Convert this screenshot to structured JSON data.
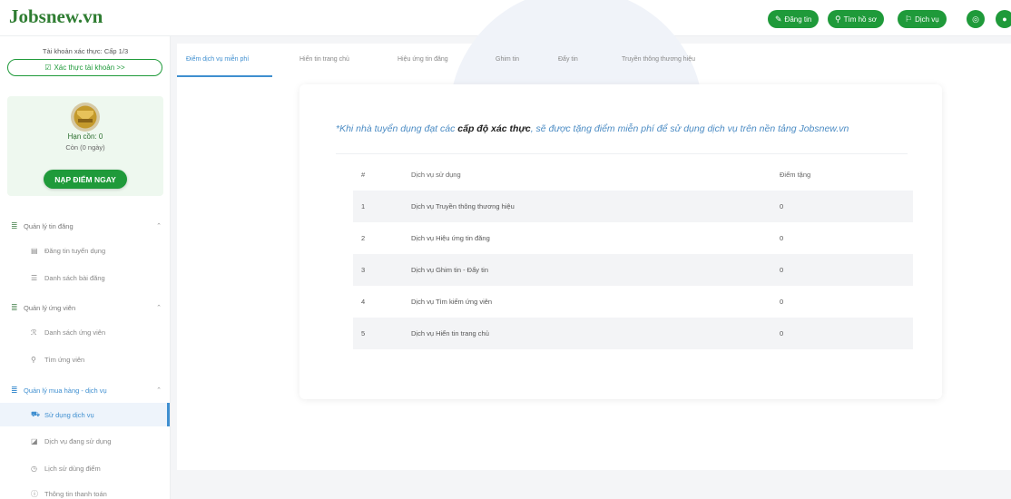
{
  "header": {
    "logo": "Jobsnew.vn",
    "buttons": [
      {
        "label": "Đăng tin",
        "icon": "edit-icon"
      },
      {
        "label": "Tìm hồ sơ",
        "icon": "search-icon"
      },
      {
        "label": "Dịch vụ",
        "icon": "service-icon"
      }
    ],
    "round_buttons": [
      {
        "icon": "bell-icon"
      },
      {
        "icon": "user-icon"
      }
    ]
  },
  "sidebar": {
    "account_level": "Tài khoản xác thực: Cấp 1/3",
    "verify_button": "Xác thực tài khoản >>",
    "rank": "Hạn cồn: 0",
    "rank_sub": "Còn (0 ngày)",
    "topup_button": "NẠP ĐIỂM NGAY",
    "groups": [
      {
        "label": "Quản lý tin đăng",
        "items": [
          "Đăng tin tuyển dụng",
          "Danh sách bài đăng"
        ]
      },
      {
        "label": "Quản lý ứng viên",
        "items": [
          "Danh sách ứng viên",
          "Tìm ứng viên"
        ]
      },
      {
        "label": "Quản lý mua hàng - dịch vụ",
        "items": [
          "Sử dụng dịch vụ",
          "Dịch vụ đang sử dụng",
          "Lịch sử dùng điểm",
          "Thông tin thanh toán"
        ]
      }
    ]
  },
  "tabs": [
    "Điểm dịch vụ miễn phí",
    "Hiển tin trang chủ",
    "Hiệu ứng tin đăng",
    "Ghim tin",
    "Đẩy tin",
    "Truyền thông thương hiệu"
  ],
  "note": {
    "prefix": "*Khi nhà tuyển dụng đạt các ",
    "bold": "cấp độ xác thực",
    "suffix": ", sẽ được tặng điểm miễn phí để sử dụng dịch vụ trên nền tảng Jobsnew.vn"
  },
  "table": {
    "headers": [
      "#",
      "Dịch vụ sử dụng",
      "Điểm tặng"
    ],
    "rows": [
      [
        "1",
        "Dịch vụ Truyền thông thương hiệu",
        "0"
      ],
      [
        "2",
        "Dịch vụ Hiệu ứng tin đăng",
        "0"
      ],
      [
        "3",
        "Dịch vụ Ghim tin - Đẩy tin",
        "0"
      ],
      [
        "4",
        "Dịch vụ Tìm kiếm ứng viên",
        "0"
      ],
      [
        "5",
        "Dịch vụ Hiển tin trang chủ",
        "0"
      ]
    ]
  },
  "colors": {
    "brand_green": "#1f9a3a",
    "accent_blue": "#3f8fd0"
  }
}
